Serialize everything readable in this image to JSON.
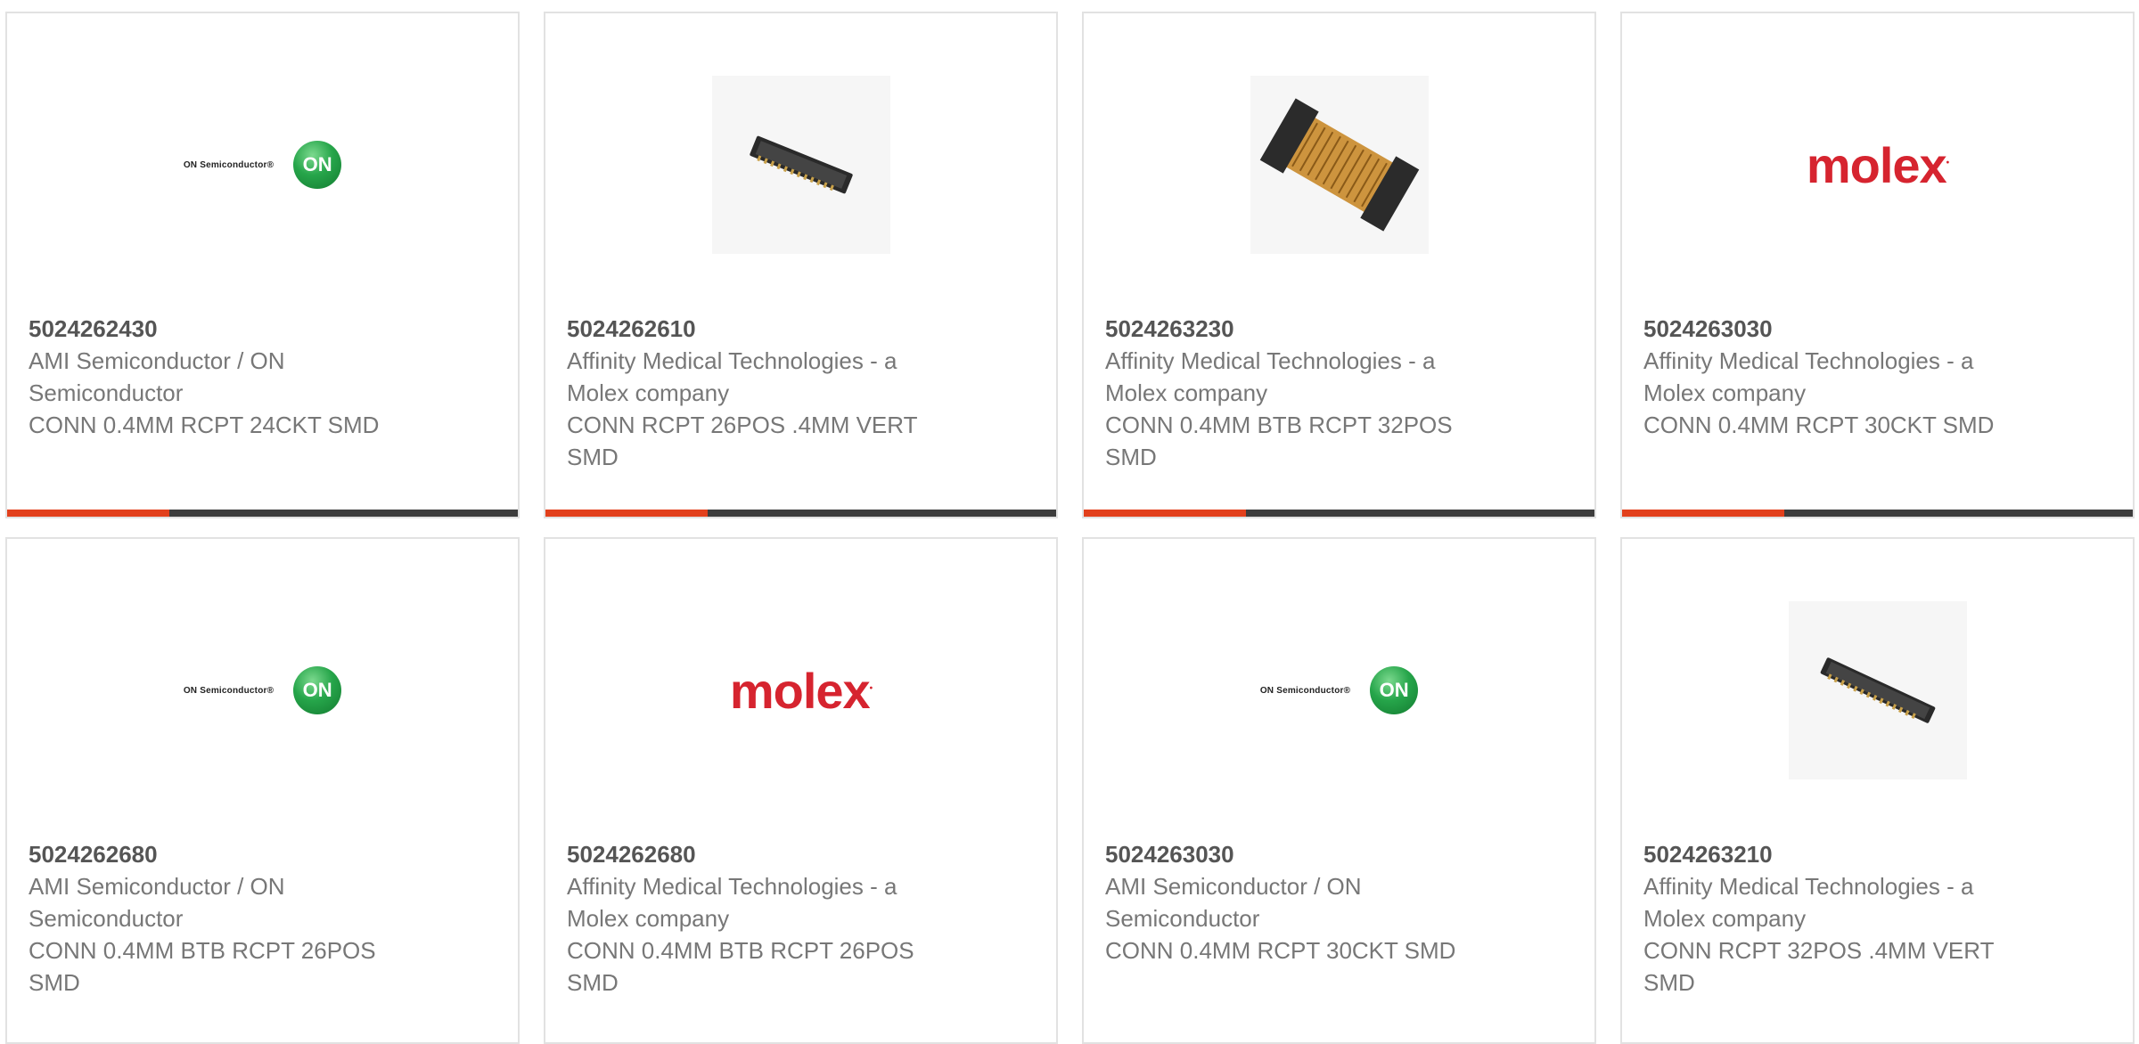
{
  "products": [
    {
      "part": "5024262430",
      "manufacturer": "AMI Semiconductor / ON Semiconductor",
      "description": "CONN 0.4MM RCPT 24CKT SMD",
      "image": "on-semiconductor-logo",
      "logo_text": "ON Semiconductor®",
      "logo_badge": "ON"
    },
    {
      "part": "5024262610",
      "manufacturer": "Affinity Medical Technologies - a Molex company",
      "description": "CONN RCPT 26POS .4MM VERT SMD",
      "image": "connector-photo-small"
    },
    {
      "part": "5024263230",
      "manufacturer": "Affinity Medical Technologies - a Molex company",
      "description": "CONN 0.4MM BTB RCPT 32POS SMD",
      "image": "connector-photo-flex"
    },
    {
      "part": "5024263030",
      "manufacturer": "Affinity Medical Technologies - a Molex company",
      "description": "CONN 0.4MM RCPT 30CKT SMD",
      "image": "molex-logo",
      "logo_text": "molex"
    },
    {
      "part": "5024262680",
      "manufacturer": "AMI Semiconductor / ON Semiconductor",
      "description": "CONN 0.4MM BTB RCPT 26POS SMD",
      "image": "on-semiconductor-logo",
      "logo_text": "ON Semiconductor®",
      "logo_badge": "ON"
    },
    {
      "part": "5024262680",
      "manufacturer": "Affinity Medical Technologies - a Molex company",
      "description": "CONN 0.4MM BTB RCPT 26POS SMD",
      "image": "molex-logo",
      "logo_text": "molex"
    },
    {
      "part": "5024263030",
      "manufacturer": "AMI Semiconductor / ON Semiconductor",
      "description": "CONN 0.4MM RCPT 30CKT SMD",
      "image": "on-semiconductor-logo",
      "logo_text": "ON Semiconductor®",
      "logo_badge": "ON"
    },
    {
      "part": "5024263210",
      "manufacturer": "Affinity Medical Technologies - a Molex company",
      "description": "CONN RCPT 32POS .4MM VERT SMD",
      "image": "connector-photo-small"
    }
  ],
  "colors": {
    "accent": "#e2401c",
    "bar": "#3d3d3d",
    "border": "#e2e2e2",
    "molex": "#d6242f",
    "on_green": "#26a54a"
  }
}
